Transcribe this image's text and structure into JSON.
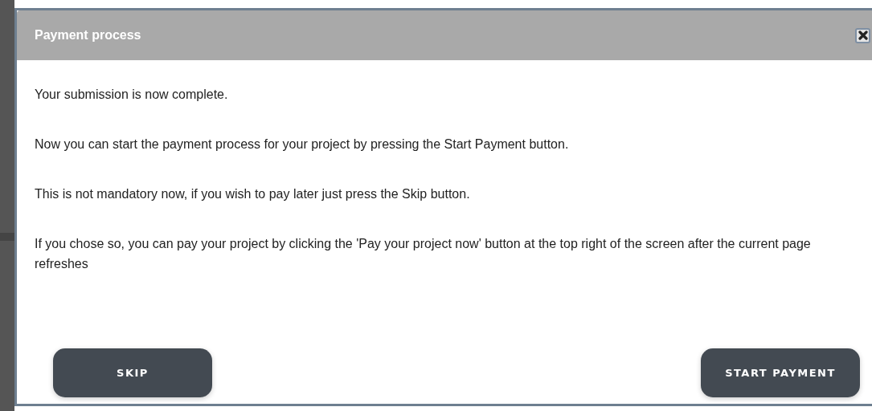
{
  "dialog": {
    "title": "Payment process",
    "paragraphs": [
      "Your submission is now complete.",
      "Now you can start the payment process for your project by pressing the Start Payment button.",
      "This is not mandatory now, if you wish to pay later just press the Skip button.",
      "If you chose so, you can pay your project by clicking the 'Pay your project now' button at the top right of the screen after the current page refreshes"
    ],
    "buttons": [
      {
        "label": "SKIP"
      },
      {
        "label": "START PAYMENT"
      }
    ]
  }
}
